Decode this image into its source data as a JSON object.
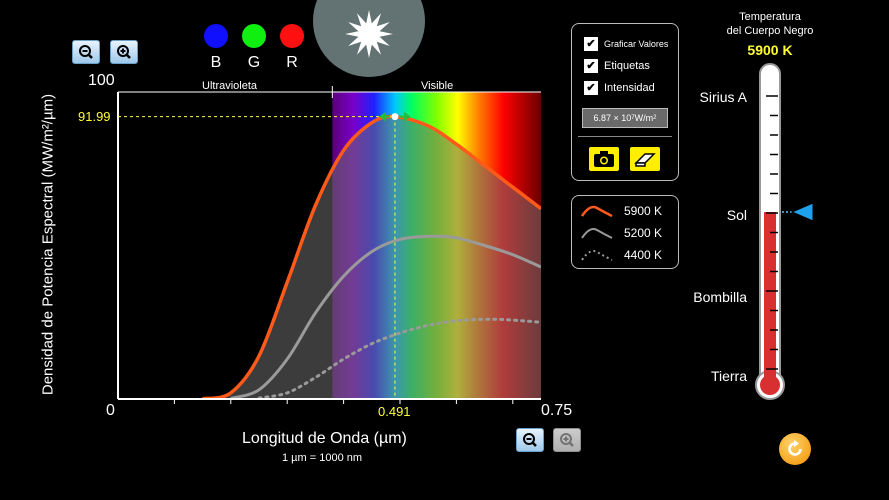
{
  "graph": {
    "y_max_label": "100",
    "y_min_label": "0",
    "x_max_label": "0.75",
    "x_peak_label": "0.491",
    "peak_value_label": "91.99",
    "band_uv_label": "Ultravioleta",
    "band_visible_label": "Visible",
    "y_axis_title": "Densidad de Potencia Espectral (MW/m²/µm)",
    "x_axis_title": "Longitud de Onda (µm)",
    "x_axis_subtitle": "1 µm  =  1000 nm"
  },
  "color_indicators": [
    {
      "label": "B",
      "color": "#1010ff"
    },
    {
      "label": "G",
      "color": "#10f010"
    },
    {
      "label": "R",
      "color": "#ff1010"
    }
  ],
  "controls": {
    "graph_values_label": "Graficar Valores",
    "labels_label": "Etiquetas",
    "intensity_label": "Intensidad",
    "intensity_value": "6.87 × 10",
    "intensity_exp": "7",
    "intensity_unit": " W/m",
    "intensity_unit_exp": "2"
  },
  "legend": [
    {
      "label": "5900 K",
      "color": "#ff5a1a"
    },
    {
      "label": "5200 K",
      "color": "#9a9a9a"
    },
    {
      "label": "4400 K",
      "color": "#9a9a9a"
    }
  ],
  "thermometer": {
    "title_line1": "Temperatura",
    "title_line2": "del Cuerpo Negro",
    "value": "5900 K",
    "value_color": "#ffff33",
    "marks": [
      "Sirius A",
      "Sol",
      "Bombilla",
      "Tierra"
    ],
    "level_fraction": 0.58
  },
  "chart_data": {
    "type": "line",
    "xlabel": "Longitud de Onda (µm)",
    "ylabel": "Densidad de Potencia Espectral (MW/m²/µm)",
    "xlim": [
      0,
      0.75
    ],
    "ylim": [
      0,
      100
    ],
    "peak": {
      "x": 0.491,
      "y": 91.99
    },
    "series": [
      {
        "name": "5900 K",
        "x": [
          0.15,
          0.2,
          0.25,
          0.3,
          0.35,
          0.4,
          0.45,
          0.491,
          0.55,
          0.6,
          0.65,
          0.7,
          0.75
        ],
        "y": [
          0.1,
          2,
          14,
          38,
          63,
          81,
          90,
          91.99,
          89,
          83,
          76,
          69,
          62
        ]
      },
      {
        "name": "5200 K",
        "x": [
          0.2,
          0.25,
          0.3,
          0.35,
          0.4,
          0.45,
          0.5,
          0.557,
          0.6,
          0.65,
          0.7,
          0.75
        ],
        "y": [
          0.2,
          3,
          13,
          28,
          40,
          48,
          52,
          53,
          52.5,
          50,
          47,
          43
        ]
      },
      {
        "name": "4400 K",
        "x": [
          0.25,
          0.3,
          0.35,
          0.4,
          0.45,
          0.5,
          0.55,
          0.6,
          0.659,
          0.7,
          0.75
        ],
        "y": [
          0.3,
          2,
          7,
          13,
          18,
          21.5,
          24,
          25.5,
          26,
          25.7,
          25
        ]
      }
    ]
  }
}
